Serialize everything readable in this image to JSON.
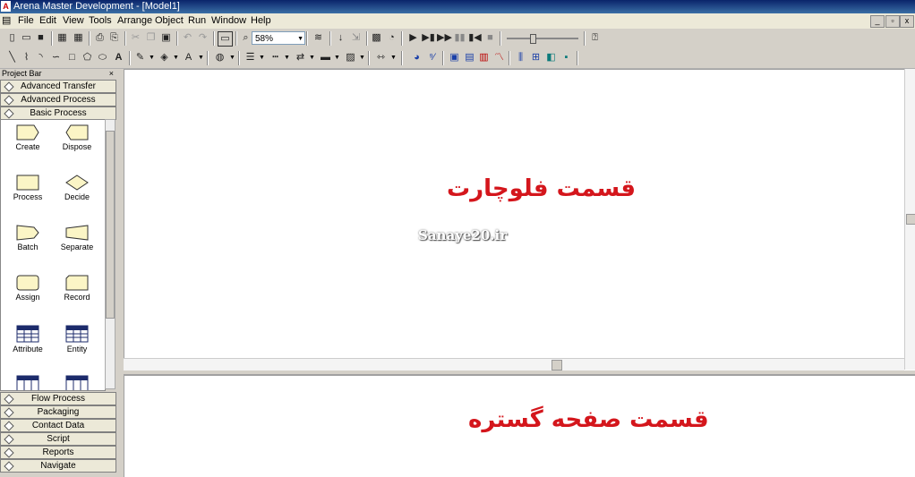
{
  "window": {
    "title": "Arena Master Development - [Model1]",
    "controls": [
      "_",
      "▫",
      "x"
    ]
  },
  "menu": [
    "File",
    "Edit",
    "View",
    "Tools",
    "Arrange",
    "Object",
    "Run",
    "Window",
    "Help"
  ],
  "toolbar": {
    "zoom": "58%"
  },
  "project_bar": {
    "title": "Project Bar",
    "close": "×",
    "top_panels": [
      "Advanced Transfer",
      "Advanced Process",
      "Basic Process"
    ],
    "modules": [
      {
        "label": "Create",
        "icon": "create-shape"
      },
      {
        "label": "Dispose",
        "icon": "dispose-shape"
      },
      {
        "label": "Process",
        "icon": "process-shape"
      },
      {
        "label": "Decide",
        "icon": "decide-shape"
      },
      {
        "label": "Batch",
        "icon": "batch-shape"
      },
      {
        "label": "Separate",
        "icon": "separate-shape"
      },
      {
        "label": "Assign",
        "icon": "assign-shape"
      },
      {
        "label": "Record",
        "icon": "record-shape"
      },
      {
        "label": "Attribute",
        "icon": "spreadsheet-icon"
      },
      {
        "label": "Entity",
        "icon": "spreadsheet-icon"
      }
    ],
    "bottom_panels": [
      "Flow Process",
      "Packaging",
      "Contact Data",
      "Script",
      "Reports",
      "Navigate"
    ]
  },
  "canvas": {
    "flowchart_label": "قسمت فلوچارت",
    "spreadsheet_label": "قسمت صفحه گستره",
    "watermark": "Sanaye20.ir"
  },
  "colors": {
    "annotation": "#d4161c",
    "titlebar": "#0a246a"
  }
}
